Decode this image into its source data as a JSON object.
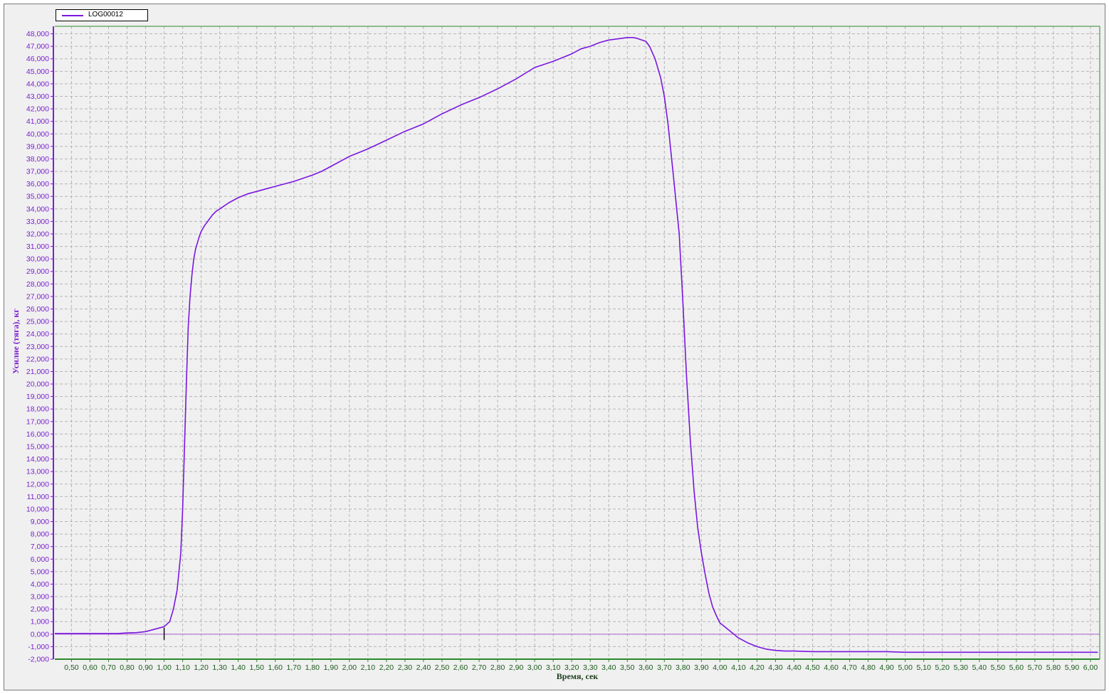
{
  "chart_data": {
    "type": "line",
    "title": "",
    "xlabel": "Время, сек",
    "ylabel": "Усилие (тяга), кг",
    "xlim": [
      0.41,
      6.05
    ],
    "ylim": [
      -2000,
      48600
    ],
    "grid": true,
    "legend_position": "top-left",
    "colors": {
      "series": "#7a16e0",
      "y_axis": "#7b1fd0",
      "x_axis": "#2b8a2b",
      "plot_background": "#f0f0f0",
      "grid": "#b5b5b5",
      "zero_line": "#b060d0"
    },
    "y_ticks": [
      "-2,000",
      "-1,000",
      "0,000",
      "1,000",
      "2,000",
      "3,000",
      "4,000",
      "5,000",
      "6,000",
      "7,000",
      "8,000",
      "9,000",
      "10,000",
      "11,000",
      "12,000",
      "13,000",
      "14,000",
      "15,000",
      "16,000",
      "17,000",
      "18,000",
      "19,000",
      "20,000",
      "21,000",
      "22,000",
      "23,000",
      "24,000",
      "25,000",
      "26,000",
      "27,000",
      "28,000",
      "29,000",
      "30,000",
      "31,000",
      "32,000",
      "33,000",
      "34,000",
      "35,000",
      "36,000",
      "37,000",
      "38,000",
      "39,000",
      "40,000",
      "41,000",
      "42,000",
      "43,000",
      "44,000",
      "45,000",
      "46,000",
      "47,000",
      "48,000"
    ],
    "x_ticks": [
      "0,50",
      "0,60",
      "0,70",
      "0,80",
      "0,90",
      "1,00",
      "1,10",
      "1,20",
      "1,30",
      "1,40",
      "1,50",
      "1,60",
      "1,70",
      "1,80",
      "1,90",
      "2,00",
      "2,10",
      "2,20",
      "2,30",
      "2,40",
      "2,50",
      "2,60",
      "2,70",
      "2,80",
      "2,90",
      "3,00",
      "3,10",
      "3,20",
      "3,30",
      "3,40",
      "3,50",
      "3,60",
      "3,70",
      "3,80",
      "3,90",
      "4,00",
      "4,10",
      "4,20",
      "4,30",
      "4,40",
      "4,50",
      "4,60",
      "4,70",
      "4,80",
      "4,90",
      "5,00",
      "5,10",
      "5,20",
      "5,30",
      "5,40",
      "5,50",
      "5,60",
      "5,70",
      "5,80",
      "5,90",
      "6,00"
    ],
    "series": [
      {
        "name": "LOG00012",
        "x": [
          0.41,
          0.6,
          0.75,
          0.8,
          0.85,
          0.9,
          0.95,
          1.0,
          1.03,
          1.05,
          1.07,
          1.09,
          1.1,
          1.11,
          1.12,
          1.13,
          1.14,
          1.15,
          1.16,
          1.17,
          1.18,
          1.19,
          1.2,
          1.22,
          1.24,
          1.26,
          1.28,
          1.3,
          1.35,
          1.4,
          1.45,
          1.5,
          1.6,
          1.7,
          1.8,
          1.85,
          1.9,
          2.0,
          2.1,
          2.2,
          2.3,
          2.4,
          2.5,
          2.6,
          2.7,
          2.8,
          2.9,
          3.0,
          3.1,
          3.2,
          3.25,
          3.3,
          3.35,
          3.4,
          3.45,
          3.5,
          3.53,
          3.55,
          3.6,
          3.62,
          3.65,
          3.68,
          3.7,
          3.72,
          3.75,
          3.78,
          3.8,
          3.82,
          3.84,
          3.86,
          3.88,
          3.9,
          3.92,
          3.94,
          3.96,
          3.98,
          4.0,
          4.05,
          4.1,
          4.15,
          4.2,
          4.25,
          4.3,
          4.35,
          4.4,
          4.5,
          4.6,
          4.7,
          4.8,
          4.9,
          5.0,
          5.1,
          5.2,
          5.4,
          5.6,
          5.8,
          6.0,
          6.04
        ],
        "y": [
          50,
          50,
          50,
          100,
          120,
          200,
          400,
          600,
          1000,
          2000,
          3500,
          6500,
          10000,
          15000,
          20000,
          24500,
          27000,
          28700,
          30000,
          30800,
          31300,
          31800,
          32200,
          32700,
          33100,
          33500,
          33800,
          34000,
          34500,
          34900,
          35200,
          35400,
          35800,
          36200,
          36700,
          37000,
          37400,
          38200,
          38800,
          39500,
          40200,
          40800,
          41600,
          42300,
          42900,
          43600,
          44400,
          45300,
          45800,
          46400,
          46800,
          47000,
          47300,
          47500,
          47600,
          47700,
          47700,
          47650,
          47400,
          47000,
          46000,
          44500,
          43000,
          40800,
          36500,
          32000,
          26500,
          20500,
          15500,
          11500,
          8500,
          6500,
          4800,
          3300,
          2200,
          1500,
          900,
          300,
          -300,
          -700,
          -1000,
          -1200,
          -1300,
          -1350,
          -1350,
          -1400,
          -1400,
          -1400,
          -1400,
          -1400,
          -1450,
          -1450,
          -1450,
          -1450,
          -1450,
          -1450,
          -1450,
          -1450
        ]
      }
    ],
    "cursor_x": 1.0
  }
}
